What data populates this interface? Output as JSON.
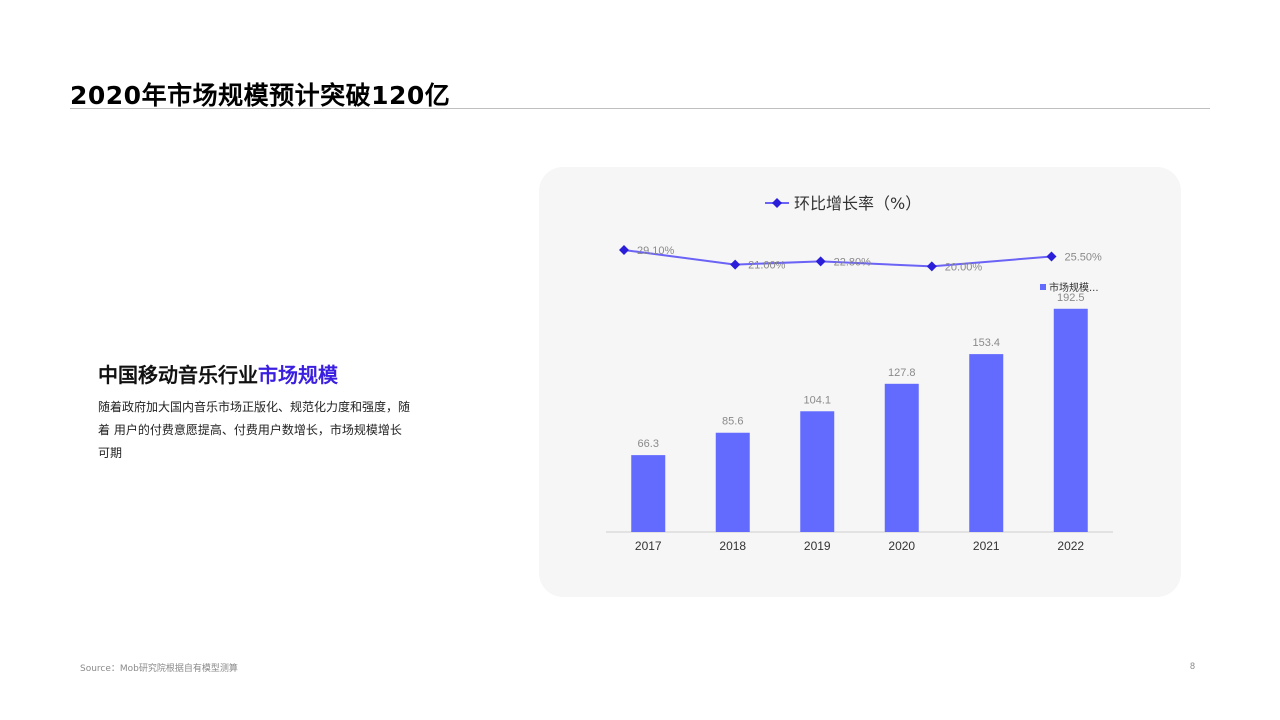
{
  "slide": {
    "title": "2020年市场规模预计突破120亿",
    "heading_main": "中国移动音乐行业",
    "heading_accent": "市场规模",
    "body": "随着政府加大国内音乐市场正版化、规范化力度和强度，随着 用户的付费意愿提高、付费用户数增长，市场规模增长可期",
    "source": "Source：Mob研究院根据自有模型测算",
    "page_number": "8"
  },
  "colors": {
    "accent": "#3a1fe0",
    "bar": "#636bff",
    "line": "#6b63f5",
    "marker": "#2a1ed9"
  },
  "chart_data": {
    "type": "bar+line",
    "categories": [
      "2017",
      "2018",
      "2019",
      "2020",
      "2021",
      "2022"
    ],
    "series": [
      {
        "name": "市场规模...",
        "type": "bar",
        "values": [
          66.3,
          85.6,
          104.1,
          127.8,
          153.4,
          192.5
        ],
        "labels": [
          "66.3",
          "85.6",
          "104.1",
          "127.8",
          "153.4",
          "192.5"
        ]
      },
      {
        "name": "环比增长率（%）",
        "type": "line",
        "values": [
          29.1,
          21.0,
          22.8,
          20.0,
          null,
          25.5
        ],
        "labels": [
          "29.10%",
          "21.00%",
          "22.80%",
          "20.00%",
          "",
          "25.50%"
        ],
        "x_positions": [
          2017,
          2018,
          2019,
          2020,
          2021,
          2022
        ]
      }
    ],
    "line_markers_at": [
      "2017",
      "2018",
      "2019",
      "2020.5",
      "2022"
    ],
    "ylim_bar": [
      0,
      210
    ],
    "ylim_line": [
      0,
      35
    ],
    "legend_line": "环比增长率（%）",
    "legend_bar": "市场规模...",
    "legend_placement": "top-center / right"
  }
}
